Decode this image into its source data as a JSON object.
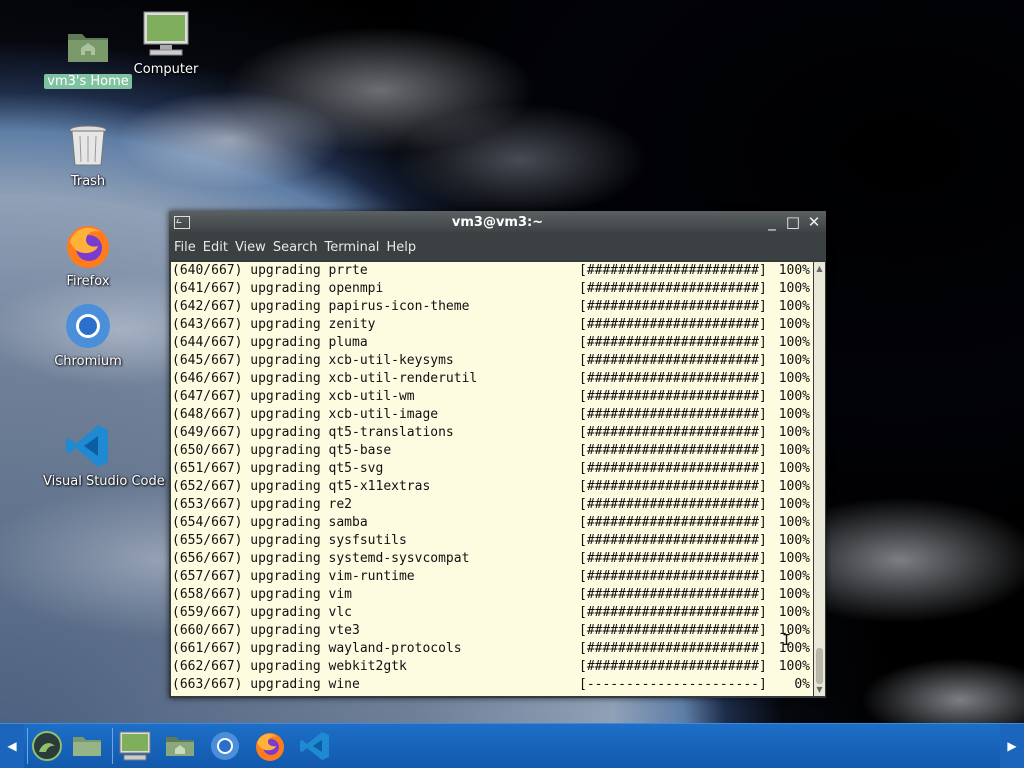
{
  "desktop": {
    "icons": [
      {
        "label": "vm3's Home"
      },
      {
        "label": "Computer"
      },
      {
        "label": "Trash"
      },
      {
        "label": "Firefox"
      },
      {
        "label": "Chromium"
      },
      {
        "label": "Visual Studio Code"
      }
    ]
  },
  "window": {
    "title": "vm3@vm3:~",
    "menu": [
      "File",
      "Edit",
      "View",
      "Search",
      "Terminal",
      "Help"
    ]
  },
  "terminal": {
    "lines": [
      {
        "text": "(640/667) upgrading prrte",
        "bar": "[######################]",
        "pct": "100%"
      },
      {
        "text": "(641/667) upgrading openmpi",
        "bar": "[######################]",
        "pct": "100%"
      },
      {
        "text": "(642/667) upgrading papirus-icon-theme",
        "bar": "[######################]",
        "pct": "100%"
      },
      {
        "text": "(643/667) upgrading zenity",
        "bar": "[######################]",
        "pct": "100%"
      },
      {
        "text": "(644/667) upgrading pluma",
        "bar": "[######################]",
        "pct": "100%"
      },
      {
        "text": "(645/667) upgrading xcb-util-keysyms",
        "bar": "[######################]",
        "pct": "100%"
      },
      {
        "text": "(646/667) upgrading xcb-util-renderutil",
        "bar": "[######################]",
        "pct": "100%"
      },
      {
        "text": "(647/667) upgrading xcb-util-wm",
        "bar": "[######################]",
        "pct": "100%"
      },
      {
        "text": "(648/667) upgrading xcb-util-image",
        "bar": "[######################]",
        "pct": "100%"
      },
      {
        "text": "(649/667) upgrading qt5-translations",
        "bar": "[######################]",
        "pct": "100%"
      },
      {
        "text": "(650/667) upgrading qt5-base",
        "bar": "[######################]",
        "pct": "100%"
      },
      {
        "text": "(651/667) upgrading qt5-svg",
        "bar": "[######################]",
        "pct": "100%"
      },
      {
        "text": "(652/667) upgrading qt5-x11extras",
        "bar": "[######################]",
        "pct": "100%"
      },
      {
        "text": "(653/667) upgrading re2",
        "bar": "[######################]",
        "pct": "100%"
      },
      {
        "text": "(654/667) upgrading samba",
        "bar": "[######################]",
        "pct": "100%"
      },
      {
        "text": "(655/667) upgrading sysfsutils",
        "bar": "[######################]",
        "pct": "100%"
      },
      {
        "text": "(656/667) upgrading systemd-sysvcompat",
        "bar": "[######################]",
        "pct": "100%"
      },
      {
        "text": "(657/667) upgrading vim-runtime",
        "bar": "[######################]",
        "pct": "100%"
      },
      {
        "text": "(658/667) upgrading vim",
        "bar": "[######################]",
        "pct": "100%"
      },
      {
        "text": "(659/667) upgrading vlc",
        "bar": "[######################]",
        "pct": "100%"
      },
      {
        "text": "(660/667) upgrading vte3",
        "bar": "[######################]",
        "pct": "100%"
      },
      {
        "text": "(661/667) upgrading wayland-protocols",
        "bar": "[######################]",
        "pct": "100%"
      },
      {
        "text": "(662/667) upgrading webkit2gtk",
        "bar": "[######################]",
        "pct": "100%"
      },
      {
        "text": "(663/667) upgrading wine",
        "bar": "[----------------------]",
        "pct": "0%"
      }
    ]
  },
  "taskbar": {
    "items": [
      "start-menu",
      "files",
      "computer",
      "home-folder",
      "chromium",
      "firefox",
      "vscode"
    ]
  }
}
